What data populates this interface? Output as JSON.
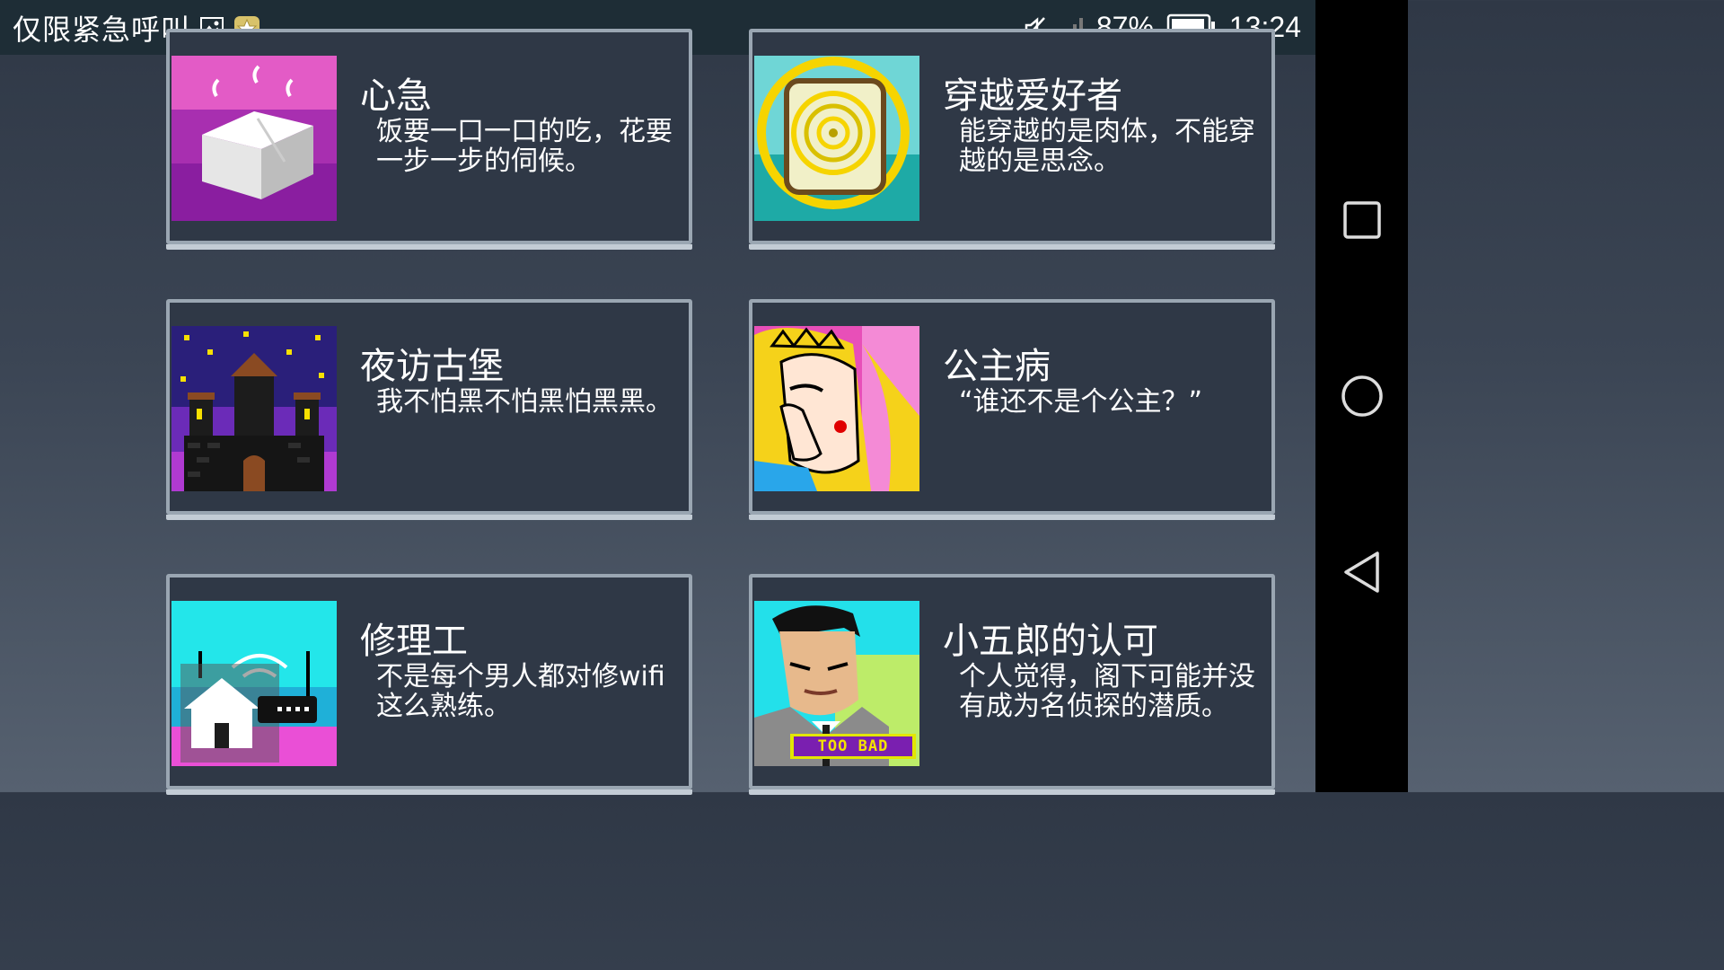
{
  "status_bar": {
    "carrier": "仅限紧急呼叫",
    "icons": [
      "image-icon",
      "star-badge-icon",
      "mute-icon",
      "signal-icon"
    ],
    "battery": "87%",
    "time": "13:24"
  },
  "nav_bar": {
    "icons": [
      "recent-apps-icon",
      "home-icon",
      "back-icon"
    ]
  },
  "cards": [
    {
      "title": "心急",
      "desc": "饭要一口一口的吃，花要一步一步的伺候。",
      "icon": "tofu-icon"
    },
    {
      "title": "穿越爱好者",
      "desc": "能穿越的是肉体，不能穿越的是思念。",
      "icon": "portal-icon"
    },
    {
      "title": "夜访古堡",
      "desc": "我不怕黑不怕黑怕黑黑。",
      "icon": "castle-icon"
    },
    {
      "title": "公主病",
      "desc": "“谁还不是个公主？”",
      "icon": "crying-princess-icon"
    },
    {
      "title": "修理工",
      "desc": "不是每个男人都对修wifi这么熟练。",
      "icon": "router-house-icon"
    },
    {
      "title": "小五郎的认可",
      "desc": "个人觉得，阁下可能并没有成为名侦探的潜质。",
      "icon": "detective-icon",
      "badge": "TOO BAD"
    }
  ]
}
